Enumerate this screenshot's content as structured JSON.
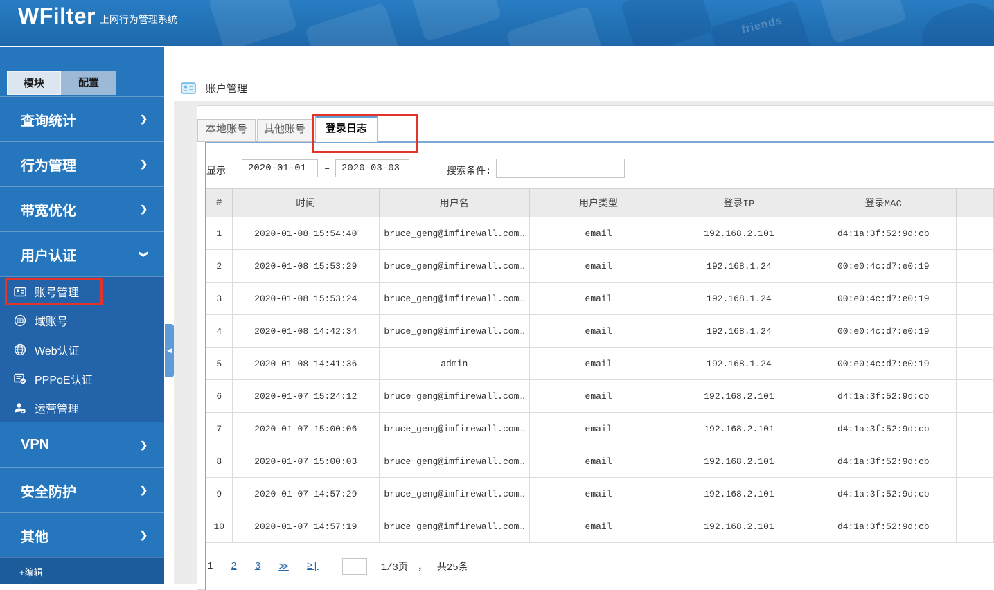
{
  "banner": {
    "logo": "WFilter",
    "subtitle": "上网行为管理系统",
    "deco_key_text": "friends"
  },
  "sidebar": {
    "mode_tabs": [
      {
        "label": "模块",
        "active": true
      },
      {
        "label": "配置",
        "active": false
      }
    ],
    "items": [
      {
        "label": "查询统计",
        "arrow": "❯"
      },
      {
        "label": "行为管理",
        "arrow": "❯"
      },
      {
        "label": "带宽优化",
        "arrow": "❯"
      },
      {
        "label": "用户认证",
        "arrow": "❯",
        "expanded": true
      },
      {
        "label": "VPN",
        "arrow": "❯"
      },
      {
        "label": "安全防护",
        "arrow": "❯"
      },
      {
        "label": "其他",
        "arrow": "❯"
      }
    ],
    "submenu": [
      {
        "label": "账号管理",
        "icon": "id-card-icon",
        "active": true
      },
      {
        "label": "域账号",
        "icon": "domain-account-icon"
      },
      {
        "label": "Web认证",
        "icon": "globe-icon"
      },
      {
        "label": "PPPoE认证",
        "icon": "pppoe-doc-check-icon"
      },
      {
        "label": "运营管理",
        "icon": "operator-user-icon"
      }
    ],
    "edit_label": "+编辑"
  },
  "main": {
    "page_title": "账户管理",
    "tabs": [
      {
        "label": "本地账号",
        "active": false
      },
      {
        "label": "其他账号",
        "active": false
      },
      {
        "label": "登录日志",
        "active": true
      }
    ],
    "filter": {
      "show_label": "显示",
      "date_from": "2020-01-01",
      "date_sep": "–",
      "date_to": "2020-03-03",
      "search_label": "搜索条件:",
      "search_value": ""
    },
    "table": {
      "headers": [
        "#",
        "时间",
        "用户名",
        "用户类型",
        "登录IP",
        "登录MAC"
      ],
      "rows": [
        [
          "1",
          "2020-01-08 15:54:40",
          "bruce_geng@imfirewall.com…",
          "email",
          "192.168.2.101",
          "d4:1a:3f:52:9d:cb"
        ],
        [
          "2",
          "2020-01-08 15:53:29",
          "bruce_geng@imfirewall.com…",
          "email",
          "192.168.1.24",
          "00:e0:4c:d7:e0:19"
        ],
        [
          "3",
          "2020-01-08 15:53:24",
          "bruce_geng@imfirewall.com…",
          "email",
          "192.168.1.24",
          "00:e0:4c:d7:e0:19"
        ],
        [
          "4",
          "2020-01-08 14:42:34",
          "bruce_geng@imfirewall.com…",
          "email",
          "192.168.1.24",
          "00:e0:4c:d7:e0:19"
        ],
        [
          "5",
          "2020-01-08 14:41:36",
          "admin",
          "email",
          "192.168.1.24",
          "00:e0:4c:d7:e0:19"
        ],
        [
          "6",
          "2020-01-07 15:24:12",
          "bruce_geng@imfirewall.com…",
          "email",
          "192.168.2.101",
          "d4:1a:3f:52:9d:cb"
        ],
        [
          "7",
          "2020-01-07 15:00:06",
          "bruce_geng@imfirewall.com…",
          "email",
          "192.168.2.101",
          "d4:1a:3f:52:9d:cb"
        ],
        [
          "8",
          "2020-01-07 15:00:03",
          "bruce_geng@imfirewall.com…",
          "email",
          "192.168.2.101",
          "d4:1a:3f:52:9d:cb"
        ],
        [
          "9",
          "2020-01-07 14:57:29",
          "bruce_geng@imfirewall.com…",
          "email",
          "192.168.2.101",
          "d4:1a:3f:52:9d:cb"
        ],
        [
          "10",
          "2020-01-07 14:57:19",
          "bruce_geng@imfirewall.com…",
          "email",
          "192.168.2.101",
          "d4:1a:3f:52:9d:cb"
        ]
      ]
    },
    "pagination": {
      "current": "1",
      "page2": "2",
      "page3": "3",
      "next": "≫",
      "last": "≥|",
      "jump_value": "",
      "info_page": "1/3页",
      "info_sep": "，",
      "info_total": "共25条"
    }
  },
  "colors": {
    "banner_blue": "#2171b5",
    "sidebar_blue": "#2676bd",
    "submenu_blue": "#2263a9",
    "edit_bar_blue": "#1d5c9b",
    "active_tab_accent": "#64a0d6",
    "panel_border_blue": "#7aaad5",
    "annotation_red": "#e4342a",
    "link_blue": "#2a6aa9",
    "table_header_gray": "#ebebeb"
  }
}
